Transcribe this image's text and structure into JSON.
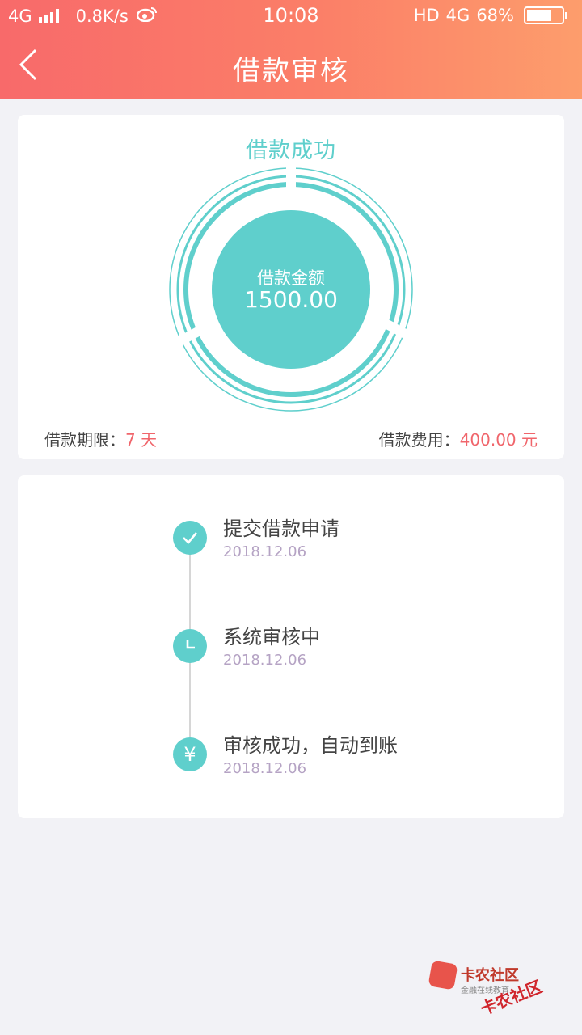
{
  "status_bar": {
    "network": "4G",
    "speed": "0.8K/s",
    "time": "10:08",
    "hd": "HD",
    "net_right": "4G",
    "battery": "68%",
    "icons": [
      "signal-icon",
      "weibo-icon",
      "battery-icon"
    ]
  },
  "nav": {
    "title": "借款审核",
    "back_icon": "chevron-left-icon"
  },
  "result": {
    "status": "借款成功",
    "amount_label": "借款金额",
    "amount_value": "1500.00",
    "term_label": "借款期限：",
    "term_value": "7 天",
    "fee_label": "借款费用：",
    "fee_value": "400.00 元"
  },
  "timeline": {
    "steps": [
      {
        "title": "提交借款申请",
        "date": "2018.12.06",
        "icon": "check-icon"
      },
      {
        "title": "系统审核中",
        "date": "2018.12.06",
        "icon": "clock-icon"
      },
      {
        "title": "审核成功，自动到账",
        "date": "2018.12.06",
        "icon": "yen-icon",
        "glyph": "¥"
      }
    ]
  },
  "watermark": {
    "line1": "卡农社区",
    "line2": "金融在线教育",
    "line3": "卡农社区"
  },
  "colors": {
    "header_start": "#f86a6a",
    "header_end": "#fd9d6c",
    "accent": "#5fcfcc",
    "amount_red": "#f0656b",
    "date_purple": "#b5a3c4"
  }
}
